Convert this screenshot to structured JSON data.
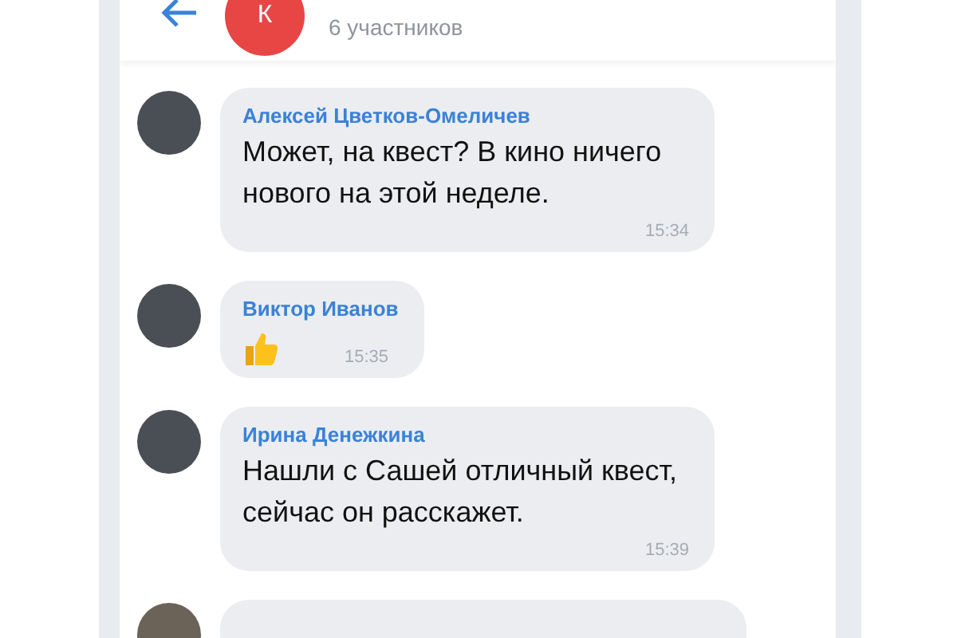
{
  "header": {
    "avatar_letter": "К",
    "subtitle": "6 участников"
  },
  "messages": [
    {
      "kind": "text",
      "author": "Алексей Цветков-Омеличев",
      "text": "Может, на квест? В кино ничего нового на этой неделе.",
      "time": "15:34"
    },
    {
      "kind": "sticker",
      "author": "Виктор Иванов",
      "time": "15:35"
    },
    {
      "kind": "text",
      "author": "Ирина Денежкина",
      "text": "Нашли с Сашей отличный квест, сейчас он расскажет.",
      "time": "15:39"
    }
  ]
}
